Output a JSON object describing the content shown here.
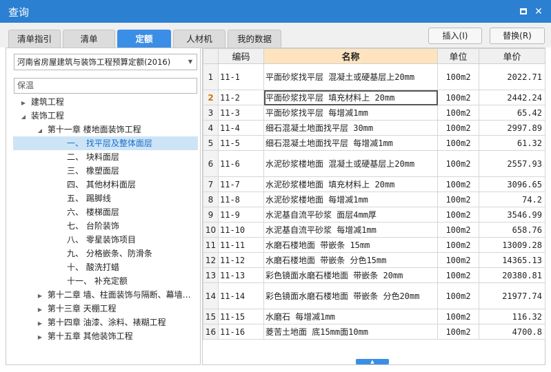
{
  "window": {
    "title": "查询"
  },
  "tabs": [
    {
      "label": "清单指引"
    },
    {
      "label": "清单"
    },
    {
      "label": "定额"
    },
    {
      "label": "人材机"
    },
    {
      "label": "我的数据"
    }
  ],
  "actions": {
    "insert": "插入(I)",
    "replace": "替换(R)"
  },
  "library": {
    "selected": "河南省房屋建筑与装饰工程预算定额(2016)"
  },
  "search": {
    "value": "保温"
  },
  "tree": [
    "建筑工程",
    "装饰工程",
    "第十一章 楼地面装饰工程",
    "一、 找平层及整体面层",
    "二、 块料面层",
    "三、 橡塑面层",
    "四、 其他材料面层",
    "五、 踢脚线",
    "六、 楼梯面层",
    "七、 台阶装饰",
    "八、 零星装饰项目",
    "九、 分格嵌条、防滑条",
    "十、 酸洗打蜡",
    "十一、 补充定额",
    "第十二章 墙、柱面装饰与隔断、幕墙…",
    "第十三章 天棚工程",
    "第十四章 油漆、涂料、裱糊工程",
    "第十五章 其他装饰工程"
  ],
  "table": {
    "headers": [
      "编码",
      "名称",
      "单位",
      "单价"
    ],
    "rows": [
      [
        "1",
        "11-1",
        "平面砂浆找平层 混凝土或硬基层上20mm",
        "100m2",
        "2022.71"
      ],
      [
        "2",
        "11-2",
        "平面砂浆找平层 填充材料上 20mm",
        "100m2",
        "2442.24"
      ],
      [
        "3",
        "11-3",
        "平面砂浆找平层 每增减1mm",
        "100m2",
        "65.42"
      ],
      [
        "4",
        "11-4",
        "细石混凝土地面找平层 30mm",
        "100m2",
        "2997.89"
      ],
      [
        "5",
        "11-5",
        "细石混凝土地面找平层 每增减1mm",
        "100m2",
        "61.32"
      ],
      [
        "6",
        "11-6",
        "水泥砂浆楼地面 混凝土或硬基层上20mm",
        "100m2",
        "2557.93"
      ],
      [
        "7",
        "11-7",
        "水泥砂浆楼地面 填充材料上 20mm",
        "100m2",
        "3096.65"
      ],
      [
        "8",
        "11-8",
        "水泥砂浆楼地面 每增减1mm",
        "100m2",
        "74.2"
      ],
      [
        "9",
        "11-9",
        "水泥基自流平砂浆 面层4mm厚",
        "100m2",
        "3546.99"
      ],
      [
        "10",
        "11-10",
        "水泥基自流平砂浆 每增减1mm",
        "100m2",
        "658.76"
      ],
      [
        "11",
        "11-11",
        "水磨石楼地面 带嵌条 15mm",
        "100m2",
        "13009.28"
      ],
      [
        "12",
        "11-12",
        "水磨石楼地面 带嵌条 分色15mm",
        "100m2",
        "14365.13"
      ],
      [
        "13",
        "11-13",
        "彩色镜面水磨石楼地面 带嵌条 20mm",
        "100m2",
        "20380.81"
      ],
      [
        "14",
        "11-14",
        "彩色镜面水磨石楼地面 带嵌条 分色20mm",
        "100m2",
        "21977.74"
      ],
      [
        "15",
        "11-15",
        "水磨石 每增减1mm",
        "100m2",
        "116.32"
      ],
      [
        "16",
        "11-16",
        "菱苦土地面 底15mm面10mm",
        "100m2",
        "4700.8"
      ]
    ]
  }
}
